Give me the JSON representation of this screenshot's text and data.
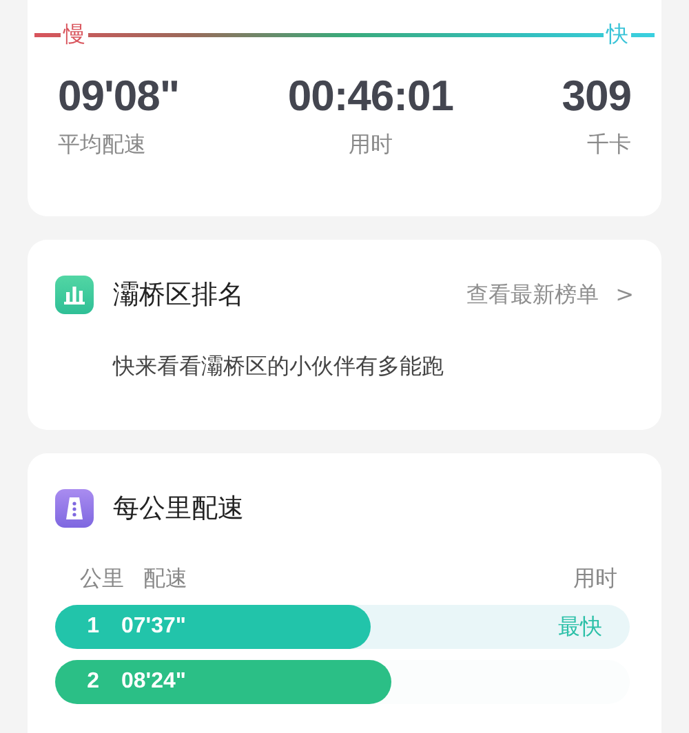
{
  "pace_legend": {
    "slow_label": "慢",
    "fast_label": "快"
  },
  "summary": [
    {
      "value": "09'08\"",
      "label": "平均配速"
    },
    {
      "value": "00:46:01",
      "label": "用时"
    },
    {
      "value": "309",
      "label": "千卡"
    }
  ],
  "ranking": {
    "title": "灞桥区排名",
    "link": "查看最新榜单",
    "chevron": ">",
    "description": "快来看看灞桥区的小伙伴有多能跑"
  },
  "splits": {
    "title": "每公里配速",
    "columns": [
      "公里",
      "配速",
      "用时"
    ],
    "rows": [
      {
        "km": "1",
        "pace": "07'37\"",
        "level": 0.55,
        "color": "#22c4aa",
        "fastest": true,
        "badge": "最快"
      },
      {
        "km": "2",
        "pace": "08'24\"",
        "level": 0.585,
        "color": "#2bbf86",
        "fastest": false
      }
    ]
  }
}
